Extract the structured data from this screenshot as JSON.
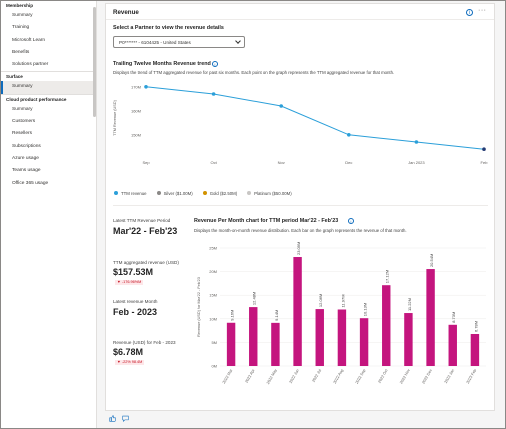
{
  "sidebar": {
    "sections": [
      {
        "title": "Membership",
        "items": [
          {
            "label": "Summary",
            "active": false
          },
          {
            "label": "Training",
            "active": false
          },
          {
            "label": "Microsoft Learn",
            "active": false
          },
          {
            "label": "Benefits",
            "active": false
          },
          {
            "label": "Solutions partner",
            "active": false
          }
        ]
      },
      {
        "title": "Surface",
        "items": [
          {
            "label": "Summary",
            "active": true
          }
        ]
      },
      {
        "title": "Cloud product performance",
        "items": [
          {
            "label": "Summary",
            "active": false
          },
          {
            "label": "Customers",
            "active": false
          },
          {
            "label": "Resellers",
            "active": false
          },
          {
            "label": "Subscriptions",
            "active": false
          },
          {
            "label": "Azure usage",
            "active": false
          },
          {
            "label": "Teams usage",
            "active": false
          },
          {
            "label": "Office 365 usage",
            "active": false
          }
        ]
      }
    ]
  },
  "header": {
    "title": "Revenue",
    "info_icon": "info-icon",
    "more_icon": "more-icon"
  },
  "partner": {
    "label": "Select a Partner to view the revenue details",
    "selected": "P0******* - 6104425 - United States"
  },
  "trend": {
    "title": "Trailing Twelve Months Revenue trend",
    "description": "Displays the trend of TTM aggregated revenue for past six months. Each point on the graph represents the TTM aggregated revenue for that month.",
    "legend": [
      {
        "label": "TTM revenue",
        "color": "#2b9fd9"
      },
      {
        "label": "Silver ($1.00M)",
        "color": "#8a8886"
      },
      {
        "label": "Gold ($2.50M)",
        "color": "#d29200"
      },
      {
        "label": "Platinum ($50.00M)",
        "color": "#c8c6c4"
      }
    ]
  },
  "kpis": {
    "period_label": "Latest TTM Revenue Period",
    "period_value": "Mar'22 - Feb'23",
    "ttm_label": "TTM aggregated revenue (USD)",
    "ttm_value": "$157.53M",
    "ttm_delta": "-176.96%M",
    "latest_month_label": "Latest revenue Month",
    "latest_month_value": "Feb - 2023",
    "month_rev_label": "Revenue (USD) for Feb - 2023",
    "month_rev_value": "$6.78M",
    "month_rev_delta": "-22% 98.4M"
  },
  "monthly": {
    "title": "Revenue Per Month chart for TTM period Mar'22 - Feb'23",
    "description": "Displays the month-on-month revenue distribution. Each bar on the graph represents the revenue of that month."
  },
  "colors": {
    "line": "#2b9fd9",
    "line_dot": "#2b9fd9",
    "last_dot": "#243a73",
    "bar": "#c4157e",
    "accent": "#0f6cbd"
  },
  "footer": {
    "like_icon": "thumbs-up-icon",
    "comment_icon": "comment-icon"
  },
  "chart_data": [
    {
      "type": "line",
      "title": "Trailing Twelve Months Revenue trend",
      "ylabel": "TTM Revenue (USD)",
      "xlabel": "",
      "x": [
        "Sep",
        "Oct",
        "Nov",
        "Dec",
        "Jan 2023",
        "Feb"
      ],
      "series": [
        {
          "name": "TTM revenue",
          "values": [
            170,
            167,
            162,
            150,
            147,
            144
          ]
        }
      ],
      "yticks": [
        "170M",
        "160M",
        "150M"
      ],
      "ytick_values": [
        170,
        160,
        150
      ],
      "ylim": [
        142,
        172
      ],
      "grid": false,
      "legend": "bottom-left"
    },
    {
      "type": "bar",
      "title": "Revenue Per Month chart for TTM period Mar'22 - Feb'23",
      "ylabel": "Revenue (USD) for Mar'22 - Feb'23",
      "xlabel": "",
      "categories": [
        "2022 Mar",
        "2022 Apr",
        "2022 May",
        "2022 Jun",
        "2022 Jul",
        "2022 Aug",
        "2022 Sep",
        "2022 Oct",
        "2022 Nov",
        "2022 Dec",
        "2023 Jan",
        "2023 Feb"
      ],
      "values": [
        9.16,
        12.48,
        9.14,
        23.09,
        12.06,
        11.97,
        10.13,
        17.12,
        11.22,
        20.54,
        8.73,
        6.78
      ],
      "labels": [
        "9.16M",
        "12.48M",
        "9.14M",
        "23.09M",
        "12.06M",
        "11.97M",
        "10.13M",
        "17.12M",
        "11.22M",
        "20.54M",
        "8.73M",
        "6.78M"
      ],
      "yticks": [
        "25M",
        "20M",
        "15M",
        "10M",
        "5M",
        "0M"
      ],
      "ytick_values": [
        25,
        20,
        15,
        10,
        5,
        0
      ],
      "ylim": [
        0,
        25
      ],
      "grid": true
    }
  ]
}
